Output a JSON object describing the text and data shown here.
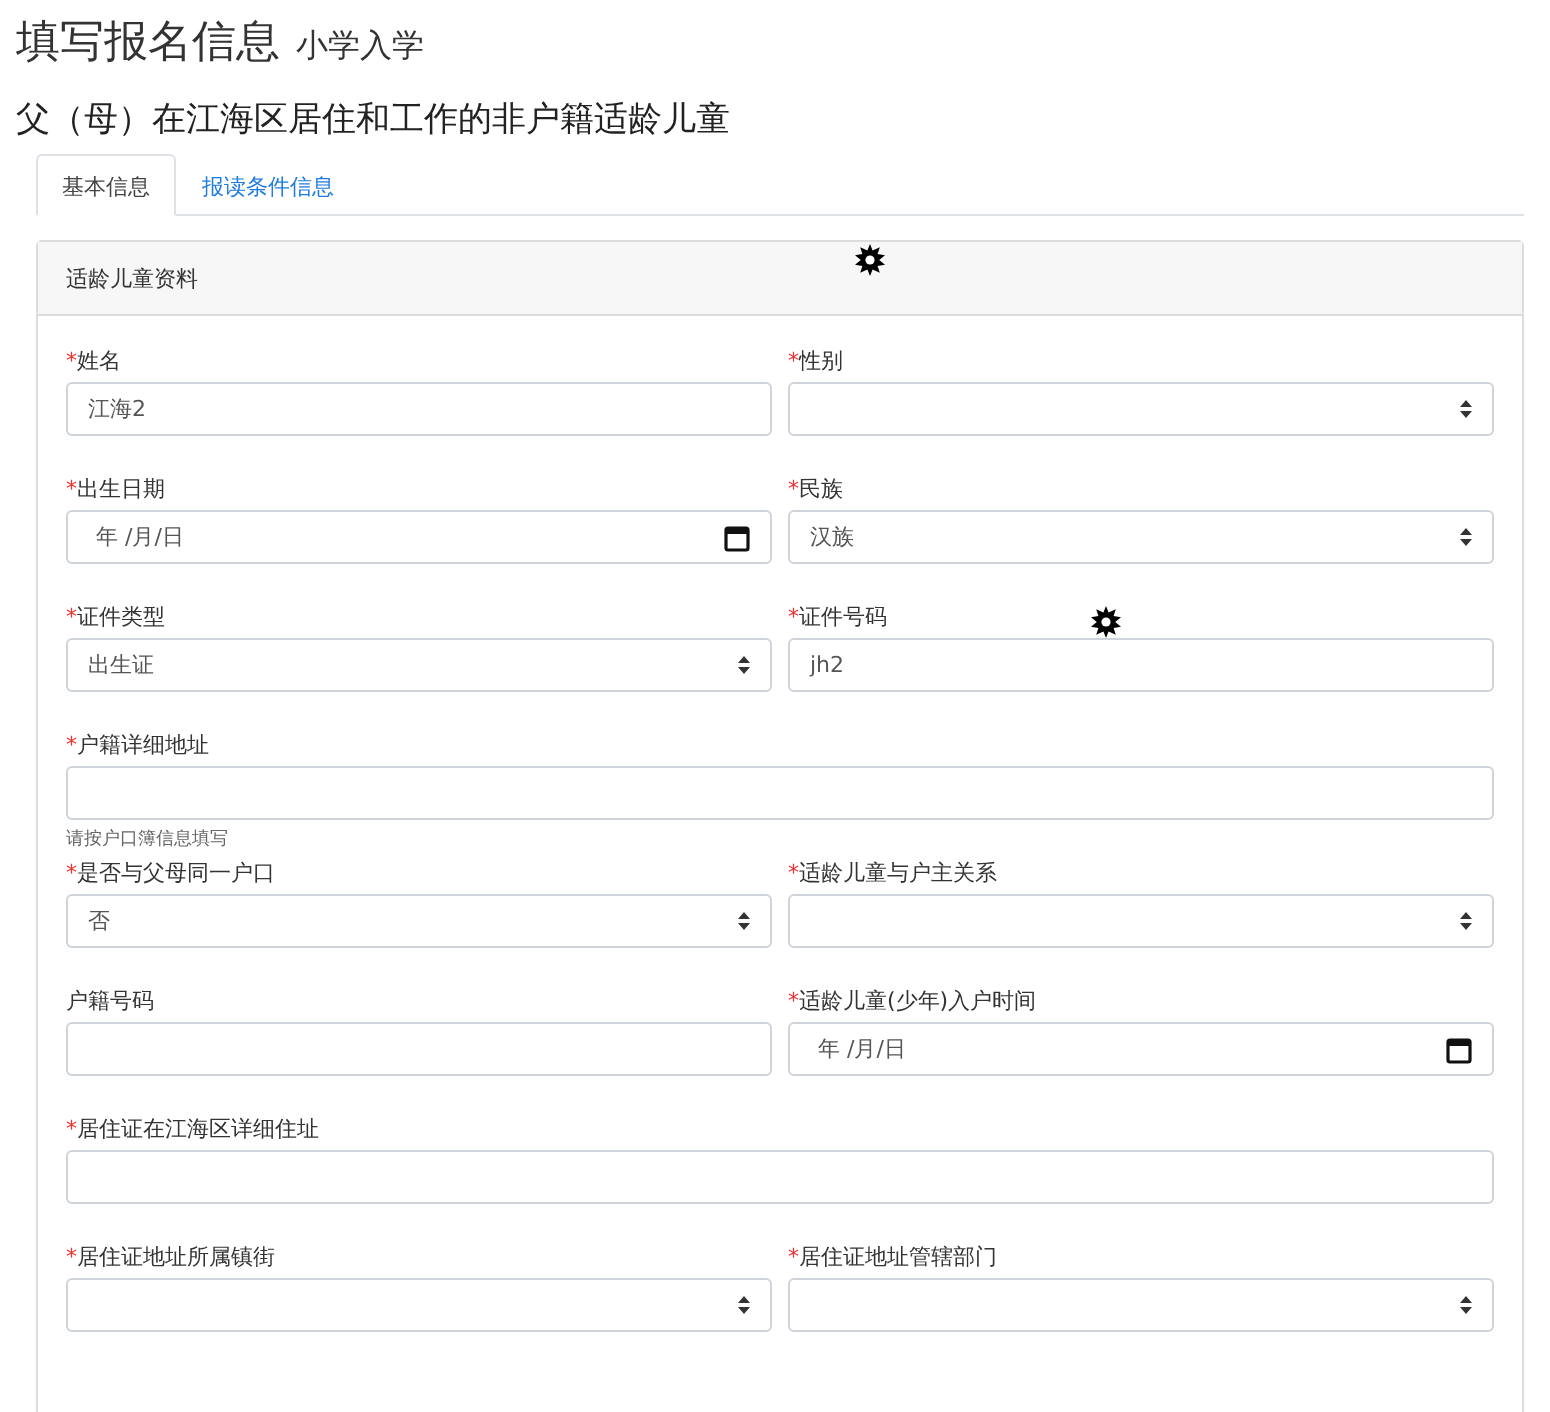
{
  "title": "填写报名信息",
  "subtitle": "小学入学",
  "category": "父（母）在江海区居住和工作的非户籍适龄儿童",
  "tabs": [
    {
      "label": "基本信息",
      "selected": true
    },
    {
      "label": "报读条件信息",
      "selected": false
    }
  ],
  "card": {
    "title": "适龄儿童资料",
    "fields": [
      {
        "kind": "text",
        "mark": "*",
        "label": "姓名",
        "value": "江海2",
        "wide": false
      },
      {
        "kind": "select",
        "mark": "*",
        "label": "性别",
        "wide": false
      },
      {
        "kind": "date",
        "mark": "*",
        "label": "出生日期",
        "value": "年 /月/日",
        "wide": false
      },
      {
        "kind": "select",
        "mark": "*",
        "label": "民族",
        "value": "汉族",
        "wide": false
      },
      {
        "kind": "select",
        "mark": "*",
        "label": "证件类型",
        "value": "出生证",
        "wide": false
      },
      {
        "kind": "text",
        "mark": "*",
        "label": "证件号码",
        "value": "jh2",
        "wide": false
      },
      {
        "kind": "text",
        "mark": "*",
        "label": "户籍详细地址",
        "hint": "请按户口簿信息填写",
        "wide": true
      },
      {
        "kind": "select",
        "mark": "*",
        "label": "是否与父母同一户口",
        "value": "否",
        "wide": false
      },
      {
        "kind": "select",
        "mark": "*",
        "label": "适龄儿童与户主关系",
        "wide": false
      },
      {
        "kind": "text",
        "label": "户籍号码",
        "wide": false
      },
      {
        "kind": "date",
        "mark": "*",
        "label": "适龄儿童(少年)入户时间",
        "value": "年 /月/日",
        "wide": false
      },
      {
        "kind": "text",
        "mark": "*",
        "label": "居住证在江海区详细住址",
        "wide": true
      },
      {
        "kind": "select",
        "mark": "*",
        "label": "居住证地址所属镇街",
        "wide": false
      },
      {
        "kind": "select",
        "mark": "*",
        "label": "居住证地址管辖部门",
        "wide": false
      }
    ]
  }
}
